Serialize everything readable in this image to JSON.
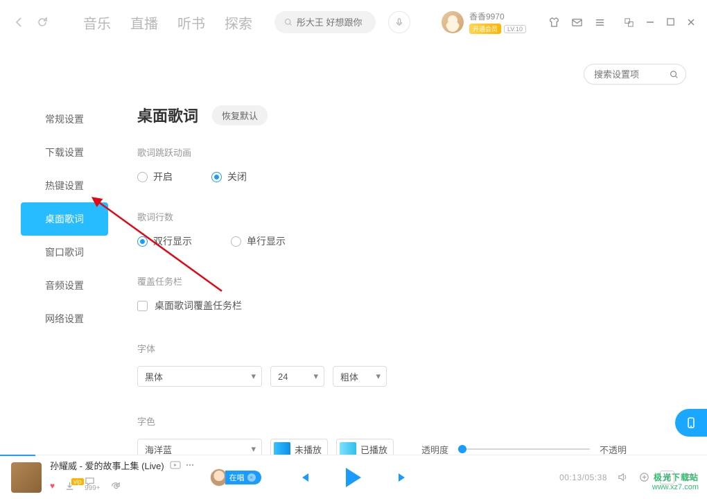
{
  "header": {
    "tabs": [
      "音乐",
      "直播",
      "听书",
      "探索"
    ],
    "search_placeholder": "彤大王 好想跟你",
    "user_name": "香香9970",
    "vip_badge": "开通会员",
    "level_badge": "LV.10"
  },
  "settings_search_placeholder": "搜索设置项",
  "sidebar": {
    "items": [
      "常规设置",
      "下载设置",
      "热键设置",
      "桌面歌词",
      "窗口歌词",
      "音频设置",
      "网络设置"
    ],
    "active_index": 3
  },
  "section": {
    "title": "桌面歌词",
    "reset": "恢复默认",
    "anim_label": "歌词跳跃动画",
    "anim_options": {
      "on": "开启",
      "off": "关闭",
      "selected": "off"
    },
    "lines_label": "歌词行数",
    "lines_options": {
      "double": "双行显示",
      "single": "单行显示",
      "selected": "double"
    },
    "taskbar_label": "覆盖任务栏",
    "taskbar_checkbox": "桌面歌词覆盖任务栏",
    "taskbar_checked": false,
    "font_label": "字体",
    "font_family": "黑体",
    "font_size": "24",
    "font_weight": "粗体",
    "color_label": "字色",
    "color_scheme": "海洋蓝",
    "color_unplayed": "未播放",
    "color_played": "已播放",
    "opacity_label": "透明度",
    "opacity_right": "不透明"
  },
  "player": {
    "track": "孙耀威 - 爱的故事上集 (Live)",
    "like_count": "999+",
    "sing_label": "在唱",
    "time": "00:13/05:38",
    "lyrics_btn": "词"
  },
  "watermark": {
    "line1": "极光下载站",
    "line2": "www.xz7.com"
  }
}
